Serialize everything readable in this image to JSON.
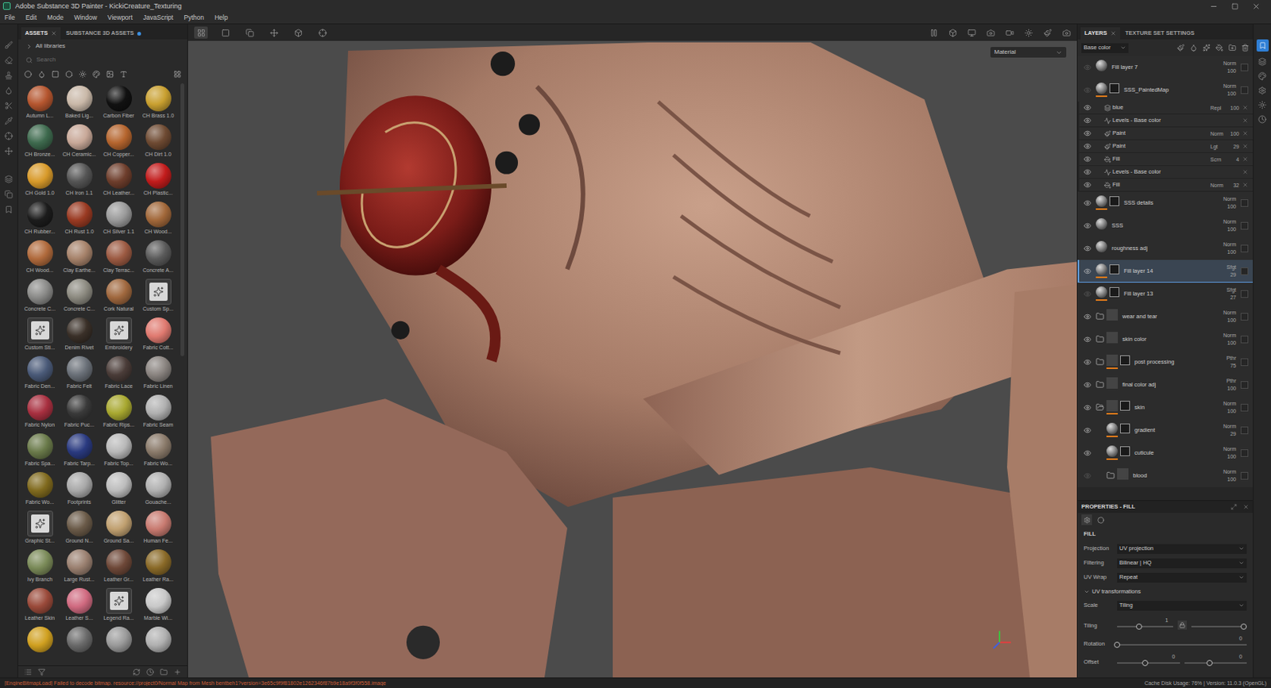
{
  "window": {
    "title": "Adobe Substance 3D Painter - KickiCreature_Texturing"
  },
  "menu": [
    "File",
    "Edit",
    "Mode",
    "Window",
    "Viewport",
    "JavaScript",
    "Python",
    "Help"
  ],
  "assets": {
    "tabs": [
      {
        "label": "ASSETS",
        "selected": true,
        "notification": false
      },
      {
        "label": "SUBSTANCE 3D ASSETS",
        "selected": false,
        "notification": true
      }
    ],
    "library": "All libraries",
    "search": {
      "placeholder": "Search"
    },
    "items": [
      {
        "label": "Autumn L...",
        "color": "#b5562f",
        "kind": "sphere"
      },
      {
        "label": "Baked Lig...",
        "color": "#c9b8a8",
        "kind": "sphere"
      },
      {
        "label": "Carbon Fiber",
        "color": "#111111",
        "kind": "sphere"
      },
      {
        "label": "CH Brass 1.0",
        "color": "#c9a030",
        "kind": "sphere"
      },
      {
        "label": "CH Bronze...",
        "color": "#3e6a4e",
        "kind": "sphere"
      },
      {
        "label": "CH Ceramic...",
        "color": "#c8a898",
        "kind": "sphere"
      },
      {
        "label": "CH Copper...",
        "color": "#b5652e",
        "kind": "sphere"
      },
      {
        "label": "CH Dirt 1.0",
        "color": "#6e4a32",
        "kind": "sphere"
      },
      {
        "label": "CH Gold 1.0",
        "color": "#d89a2a",
        "kind": "sphere"
      },
      {
        "label": "CH Iron 1.1",
        "color": "#555555",
        "kind": "sphere"
      },
      {
        "label": "CH Leather...",
        "color": "#6e3e2c",
        "kind": "sphere"
      },
      {
        "label": "CH Plastic...",
        "color": "#c21c1c",
        "kind": "sphere"
      },
      {
        "label": "CH Rubber...",
        "color": "#1c1c1c",
        "kind": "sphere"
      },
      {
        "label": "CH Rust 1.0",
        "color": "#9a3a22",
        "kind": "sphere"
      },
      {
        "label": "CH Silver 1.1",
        "color": "#9a9a9a",
        "kind": "sphere"
      },
      {
        "label": "CH Wood...",
        "color": "#a2683a",
        "kind": "sphere"
      },
      {
        "label": "CH Wood...",
        "color": "#b06a3c",
        "kind": "sphere"
      },
      {
        "label": "Clay Earthe...",
        "color": "#a6826a",
        "kind": "sphere"
      },
      {
        "label": "Clay Terrac...",
        "color": "#9c5a42",
        "kind": "sphere"
      },
      {
        "label": "Concrete A...",
        "color": "#5a5a5a",
        "kind": "sphere"
      },
      {
        "label": "Concrete C...",
        "color": "#8a8a88",
        "kind": "sphere"
      },
      {
        "label": "Concrete C...",
        "color": "#8c8a80",
        "kind": "sphere"
      },
      {
        "label": "Cork Natural",
        "color": "#a0683e",
        "kind": "sphere"
      },
      {
        "label": "Custom Sp...",
        "color": "#d8d8d8",
        "kind": "icon"
      },
      {
        "label": "Custom Sti...",
        "color": "#d8d8d8",
        "kind": "icon"
      },
      {
        "label": "Denim Rivet",
        "color": "#3a3028",
        "kind": "sphere"
      },
      {
        "label": "Embroidery",
        "color": "#d8d8d8",
        "kind": "icon"
      },
      {
        "label": "Fabric Cott...",
        "color": "#e07a70",
        "kind": "sphere"
      },
      {
        "label": "Fabric Den...",
        "color": "#4a5a78",
        "kind": "sphere"
      },
      {
        "label": "Fabric Felt",
        "color": "#6a7078",
        "kind": "sphere"
      },
      {
        "label": "Fabric Lace",
        "color": "#4a3c38",
        "kind": "sphere"
      },
      {
        "label": "Fabric Linen",
        "color": "#8a8480",
        "kind": "sphere"
      },
      {
        "label": "Fabric Nylon",
        "color": "#a83040",
        "kind": "sphere"
      },
      {
        "label": "Fabric Puc...",
        "color": "#3a3a3a",
        "kind": "sphere"
      },
      {
        "label": "Fabric Rips...",
        "color": "#a8a830",
        "kind": "sphere"
      },
      {
        "label": "Fabric Seam",
        "color": "#b0b0b0",
        "kind": "sphere"
      },
      {
        "label": "Fabric Spa...",
        "color": "#6a7a4a",
        "kind": "sphere"
      },
      {
        "label": "Fabric Tarp...",
        "color": "#2a3a80",
        "kind": "sphere"
      },
      {
        "label": "Fabric Top...",
        "color": "#b8b8b8",
        "kind": "sphere"
      },
      {
        "label": "Fabric Wo...",
        "color": "#8a7a6a",
        "kind": "sphere"
      },
      {
        "label": "Fabric Wo...",
        "color": "#806a1e",
        "kind": "sphere"
      },
      {
        "label": "Footprints",
        "color": "#a8a8a8",
        "kind": "sphere"
      },
      {
        "label": "Glitter",
        "color": "#bcbcbc",
        "kind": "sphere"
      },
      {
        "label": "Gouache...",
        "color": "#b0b0b0",
        "kind": "sphere"
      },
      {
        "label": "Graphic St...",
        "color": "#d8d8d8",
        "kind": "icon"
      },
      {
        "label": "Ground N...",
        "color": "#6a5a48",
        "kind": "sphere"
      },
      {
        "label": "Ground Sa...",
        "color": "#c0a070",
        "kind": "sphere"
      },
      {
        "label": "Human Fe...",
        "color": "#c87a70",
        "kind": "sphere"
      },
      {
        "label": "Ivy Branch",
        "color": "#7a8a58",
        "kind": "sphere"
      },
      {
        "label": "Large Rust...",
        "color": "#9a8070",
        "kind": "sphere"
      },
      {
        "label": "Leather Gr...",
        "color": "#6e4838",
        "kind": "sphere"
      },
      {
        "label": "Leather Ra...",
        "color": "#8a6a28",
        "kind": "sphere"
      },
      {
        "label": "Leather Skin",
        "color": "#9a4a3a",
        "kind": "sphere"
      },
      {
        "label": "Leather S...",
        "color": "#d06a80",
        "kind": "sphere"
      },
      {
        "label": "Legend Ra...",
        "color": "#d8d8d8",
        "kind": "icon"
      },
      {
        "label": "Marble Wi...",
        "color": "#c8c8c8",
        "kind": "sphere"
      },
      {
        "label": "",
        "color": "#d0a020",
        "kind": "sphere"
      },
      {
        "label": "",
        "color": "#6a6a6a",
        "kind": "sphere"
      },
      {
        "label": "",
        "color": "#9a9a9a",
        "kind": "sphere"
      },
      {
        "label": "",
        "color": "#b0b0b0",
        "kind": "sphere"
      }
    ]
  },
  "viewport": {
    "mode": "Material"
  },
  "layers": {
    "tabs": [
      {
        "label": "LAYERS",
        "selected": true
      },
      {
        "label": "TEXTURE SET SETTINGS",
        "selected": false
      }
    ],
    "channel": "Base color",
    "rows": [
      {
        "name": "Fill layer 7",
        "blend": "Norm",
        "opacity": "100",
        "visible": false,
        "selected": false,
        "depth": 0,
        "kind": "fill",
        "mask": false
      },
      {
        "name": "SSS_PaintedMap",
        "blend": "Norm",
        "opacity": "100",
        "visible": false,
        "selected": false,
        "depth": 0,
        "kind": "paint",
        "mask": true
      },
      {
        "name": "blue",
        "blend": "Repl",
        "opacity": "100",
        "visible": true,
        "selected": false,
        "depth": 1,
        "kind": "filter",
        "mask": false
      },
      {
        "name": "Levels - Base color",
        "blend": "",
        "opacity": "",
        "visible": true,
        "selected": false,
        "depth": 1,
        "kind": "levels",
        "mask": false
      },
      {
        "name": "Paint",
        "blend": "Norm",
        "opacity": "100",
        "visible": true,
        "selected": false,
        "depth": 1,
        "kind": "brush",
        "mask": false
      },
      {
        "name": "Paint",
        "blend": "Lgt",
        "opacity": "29",
        "visible": true,
        "selected": false,
        "depth": 1,
        "kind": "brush",
        "mask": false
      },
      {
        "name": "Fill",
        "blend": "Scrn",
        "opacity": "4",
        "visible": true,
        "selected": false,
        "depth": 1,
        "kind": "bucket",
        "mask": false
      },
      {
        "name": "Levels - Base color",
        "blend": "",
        "opacity": "",
        "visible": true,
        "selected": false,
        "depth": 1,
        "kind": "levels",
        "mask": false
      },
      {
        "name": "Fill",
        "blend": "Norm",
        "opacity": "32",
        "visible": true,
        "selected": false,
        "depth": 1,
        "kind": "bucket",
        "mask": false
      },
      {
        "name": "SSS details",
        "blend": "Norm",
        "opacity": "100",
        "visible": true,
        "selected": false,
        "depth": 0,
        "kind": "fill",
        "mask": true
      },
      {
        "name": "SSS",
        "blend": "Norm",
        "opacity": "100",
        "visible": true,
        "selected": false,
        "depth": 0,
        "kind": "fill",
        "mask": false
      },
      {
        "name": "roughness adj",
        "blend": "Norm",
        "opacity": "100",
        "visible": true,
        "selected": false,
        "depth": 0,
        "kind": "fill",
        "mask": false
      },
      {
        "name": "Fill layer 14",
        "blend": "Sfgt",
        "opacity": "29",
        "visible": true,
        "selected": true,
        "depth": 0,
        "kind": "fill",
        "mask": true
      },
      {
        "name": "Fill layer 13",
        "blend": "Sfgt",
        "opacity": "27",
        "visible": false,
        "selected": false,
        "depth": 0,
        "kind": "fill",
        "mask": true
      },
      {
        "name": "wear and tear",
        "blend": "Norm",
        "opacity": "100",
        "visible": true,
        "selected": false,
        "depth": 0,
        "kind": "folder",
        "mask": false,
        "expanded": false
      },
      {
        "name": "skin color",
        "blend": "Norm",
        "opacity": "100",
        "visible": true,
        "selected": false,
        "depth": 0,
        "kind": "folder",
        "mask": false,
        "expanded": false
      },
      {
        "name": "post processing",
        "blend": "Pthr",
        "opacity": "75",
        "visible": true,
        "selected": false,
        "depth": 0,
        "kind": "folder",
        "mask": true,
        "expanded": false
      },
      {
        "name": "final color adj",
        "blend": "Pthr",
        "opacity": "100",
        "visible": true,
        "selected": false,
        "depth": 0,
        "kind": "folder",
        "mask": false,
        "expanded": false
      },
      {
        "name": "skin",
        "blend": "Norm",
        "opacity": "100",
        "visible": true,
        "selected": false,
        "depth": 0,
        "kind": "folder",
        "mask": true,
        "expanded": true
      },
      {
        "name": "gradient",
        "blend": "Norm",
        "opacity": "29",
        "visible": true,
        "selected": false,
        "depth": 1,
        "kind": "fill",
        "mask": true
      },
      {
        "name": "cuticule",
        "blend": "Norm",
        "opacity": "100",
        "visible": true,
        "selected": false,
        "depth": 1,
        "kind": "fill",
        "mask": true
      },
      {
        "name": "blood",
        "blend": "Norm",
        "opacity": "100",
        "visible": false,
        "selected": false,
        "depth": 1,
        "kind": "folder",
        "mask": false,
        "expanded": false
      }
    ]
  },
  "properties": {
    "title": "PROPERTIES - FILL",
    "section": "FILL",
    "fields": [
      {
        "label": "Projection",
        "value": "UV projection"
      },
      {
        "label": "Filtering",
        "value": "Bilinear | HQ"
      },
      {
        "label": "UV Wrap",
        "value": "Repeat"
      }
    ],
    "group": {
      "label": "UV transformations",
      "expanded": true
    },
    "scale": {
      "label": "Scale",
      "value": "Tiling"
    },
    "sliders": [
      {
        "label": "Tiling",
        "linked": true,
        "tracks": [
          {
            "value": "1",
            "level": 0.4
          },
          {
            "value": "",
            "level": 0.95
          }
        ]
      },
      {
        "label": "Rotation",
        "linked": false,
        "tracks": [
          {
            "value": "0",
            "level": 0
          }
        ]
      },
      {
        "label": "Offset",
        "linked": false,
        "tracks": [
          {
            "value": "0",
            "level": 0.45
          },
          {
            "value": "0",
            "level": 0.4
          }
        ]
      }
    ]
  },
  "status_bar": {
    "message": "[EngineBitmapLoad] Failed to decode bitmap. resource://project0/Normal Map from Mesh bentbeh1?version=3e65c9f9f81802e1262346f87b9e18a9f3f0f558.image",
    "info": "Cache Disk Usage: 76% | Version: 11.0.3 (OpenGL)"
  }
}
